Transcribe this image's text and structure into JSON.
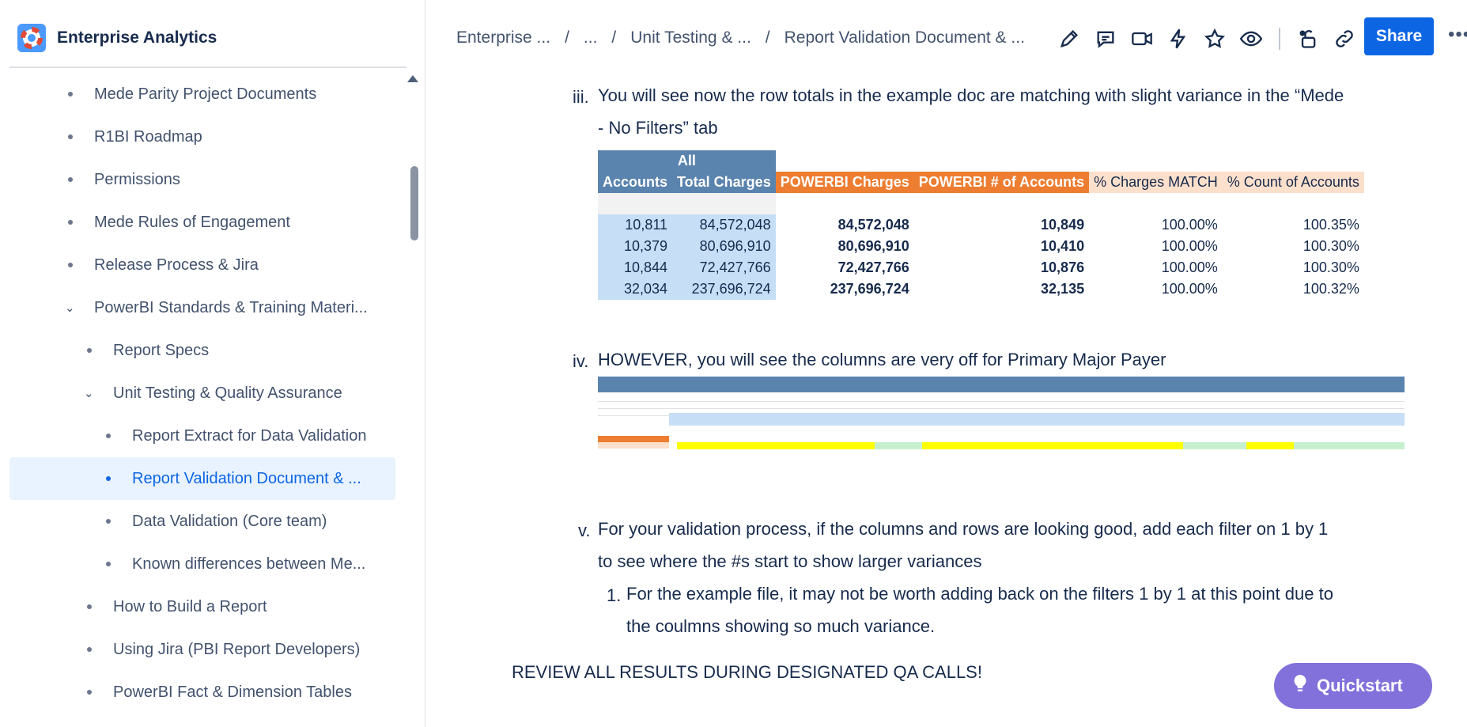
{
  "sidebar": {
    "space_title": "Enterprise Analytics",
    "items": [
      {
        "label": "Mede Parity Project Documents",
        "level": 1,
        "type": "bullet"
      },
      {
        "label": "R1BI Roadmap",
        "level": 1,
        "type": "bullet"
      },
      {
        "label": "Permissions",
        "level": 1,
        "type": "bullet"
      },
      {
        "label": "Mede Rules of Engagement",
        "level": 1,
        "type": "bullet"
      },
      {
        "label": "Release Process & Jira",
        "level": 1,
        "type": "bullet"
      },
      {
        "label": "PowerBI Standards & Training Materi...",
        "level": 1,
        "type": "chevron"
      },
      {
        "label": "Report Specs",
        "level": 2,
        "type": "bullet"
      },
      {
        "label": "Unit Testing & Quality Assurance",
        "level": 2,
        "type": "chevron"
      },
      {
        "label": "Report Extract for Data Validation",
        "level": 3,
        "type": "bullet"
      },
      {
        "label": "Report Validation Document & ...",
        "level": 3,
        "type": "bullet",
        "selected": true
      },
      {
        "label": "Data Validation (Core team)",
        "level": 3,
        "type": "bullet"
      },
      {
        "label": "Known differences between Me...",
        "level": 3,
        "type": "bullet"
      },
      {
        "label": "How to Build a Report",
        "level": 2,
        "type": "bullet"
      },
      {
        "label": "Using Jira (PBI Report Developers)",
        "level": 2,
        "type": "bullet"
      },
      {
        "label": "PowerBI Fact & Dimension Tables",
        "level": 2,
        "type": "bullet"
      }
    ]
  },
  "breadcrumb": [
    "Enterprise ...",
    "...",
    "Unit Testing & ...",
    "Report Validation Document & ..."
  ],
  "toolbar": {
    "icons": [
      "edit-icon",
      "comment-icon",
      "video-icon",
      "automation-icon",
      "star-icon",
      "watch-icon",
      "restrictions-icon",
      "link-icon"
    ],
    "share_label": "Share",
    "more_label": "•••"
  },
  "content": {
    "step_iii_marker": "iii.",
    "step_iii_text": "You will see now the row totals in the example doc are matching with slight variance in the “Mede",
    "step_iii_text2": "- No Filters” tab",
    "table1": {
      "group_header": "All",
      "headers": [
        "Accounts",
        "Total Charges",
        "POWERBI Charges",
        "POWERBI # of Accounts",
        "% Charges MATCH",
        "% Count of Accounts"
      ],
      "rows": [
        [
          "10,811",
          "84,572,048",
          "84,572,048",
          "10,849",
          "100.00%",
          "100.35%"
        ],
        [
          "10,379",
          "80,696,910",
          "80,696,910",
          "10,410",
          "100.00%",
          "100.30%"
        ],
        [
          "10,844",
          "72,427,766",
          "72,427,766",
          "10,876",
          "100.00%",
          "100.30%"
        ],
        [
          "32,034",
          "237,696,724",
          "237,696,724",
          "32,135",
          "100.00%",
          "100.32%"
        ]
      ]
    },
    "step_iv_marker": "iv.",
    "step_iv_text": "HOWEVER, you will see the columns are very off for Primary Major Payer",
    "step_v_marker": "v.",
    "step_v_text": "For your validation process, if the columns and rows are looking good, add each filter on 1 by 1",
    "step_v_text2": "to see where the #s start to show larger variances",
    "sub1_marker": "1.",
    "sub1_text": "For the example file, it may not be worth adding back on the filters 1 by 1 at this point due to",
    "sub1_text2": "the coulmns showing so much variance.",
    "review_text": "REVIEW ALL RESULTS DURING DESIGNATED QA CALLS!"
  },
  "quickstart": {
    "label": "Quickstart"
  },
  "colors": {
    "accent": "#0c66e4",
    "quickstart": "#8270db",
    "header_blue": "#5a83ae",
    "header_orange": "#ed7d31",
    "highlight_yellow": "#ffff00"
  }
}
